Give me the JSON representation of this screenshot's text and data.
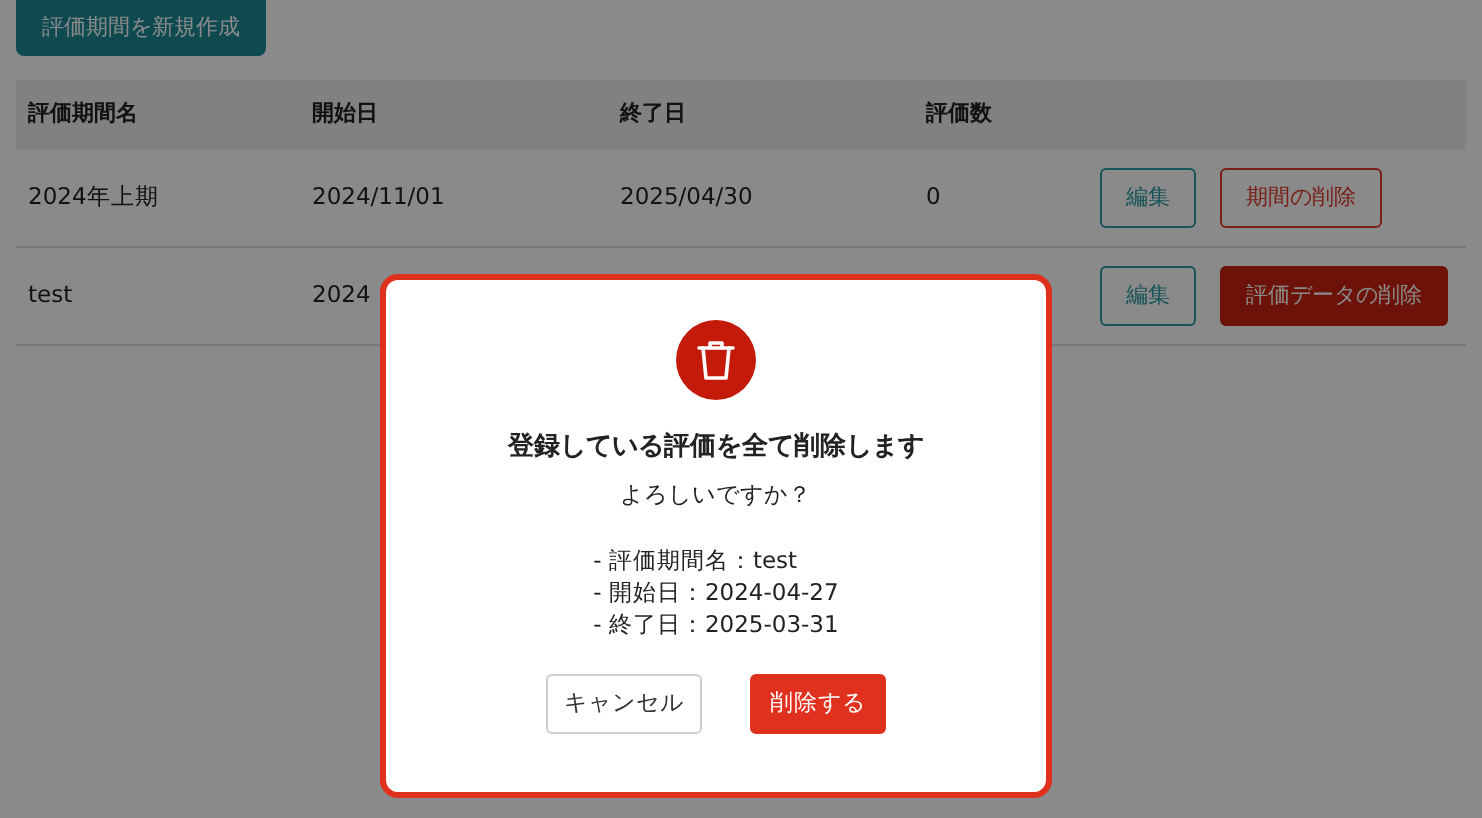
{
  "create_button": "評価期間を新規作成",
  "table": {
    "columns": [
      "評価期間名",
      "開始日",
      "終了日",
      "評価数",
      ""
    ],
    "rows": [
      {
        "cells": [
          "2024年上期",
          "2024/11/01",
          "2025/04/30",
          "0"
        ],
        "actions": [
          {
            "label": "編集",
            "kind": "edit"
          },
          {
            "label": "期間の削除",
            "kind": "delete-outline"
          }
        ]
      },
      {
        "cells": [
          "test",
          "2024"
        ],
        "actions": [
          {
            "label": "編集",
            "kind": "edit"
          },
          {
            "label": "評価データの削除",
            "kind": "delete-solid"
          }
        ]
      }
    ]
  },
  "dialog": {
    "title": "登録している評価を全て削除します",
    "subtitle": "よろしいですか？",
    "details": [
      "-  評価期間名：test",
      "-  開始日：2024-04-27",
      "-  終了日：2025-03-31"
    ],
    "buttons": [
      {
        "label": "キャンセル",
        "kind": "cancel"
      },
      {
        "label": "削除する",
        "kind": "confirm"
      }
    ]
  }
}
